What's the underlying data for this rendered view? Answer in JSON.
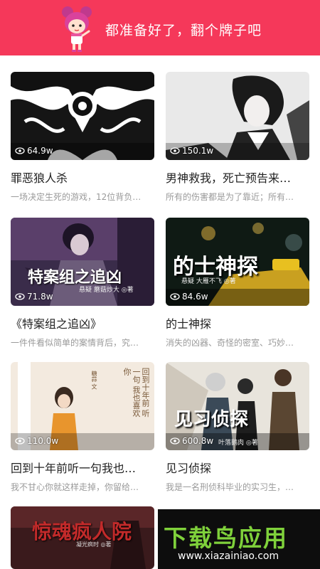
{
  "header": {
    "title": "都准备好了，翻个牌子吧",
    "mascot_icon": "cartoon-girl-mascot",
    "background_color": "#f5385a"
  },
  "stories": [
    {
      "title": "罪恶狼人杀",
      "desc": "一场决定生死的游戏，12位背负…",
      "views": "64.9w",
      "cover_text": "",
      "cover_author": ""
    },
    {
      "title": "男神救我，死亡预告来…",
      "desc": "所有的伤害都是为了靠近；所有…",
      "views": "150.1w",
      "cover_text": "",
      "cover_author": ""
    },
    {
      "title": "《特案组之追凶》",
      "desc": "一件件看似简单的案情背后，究…",
      "views": "71.8w",
      "cover_text": "特案组之追凶",
      "cover_author": "悬疑  蘑菇炒大  ◎著"
    },
    {
      "title": "的士神探",
      "desc": "消失的凶器、奇怪的密室、巧妙…",
      "views": "84.6w",
      "cover_text": "的士神探",
      "cover_author": "悬疑  大雁不飞  ◎著"
    },
    {
      "title": "回到十年前听一句我也…",
      "desc": "我不甘心你就这样走掉，你留给…",
      "views": "110.0w",
      "cover_text": "回到十年前 听一句 我也喜欢你",
      "cover_author": "糖蒜 文"
    },
    {
      "title": "见习侦探",
      "desc": "我是一名刑侦科毕业的实习生，…",
      "views": "600.8w",
      "cover_text": "见习侦探",
      "cover_author": "叶落鹅肉  ◎著"
    },
    {
      "title": "",
      "desc": "",
      "views": "",
      "cover_text": "惊魂疯人院",
      "cover_author": "凝光疯时  ◎著"
    }
  ],
  "watermark": {
    "main": "下载鸟应用",
    "url": "www.xiazainiao.com"
  }
}
